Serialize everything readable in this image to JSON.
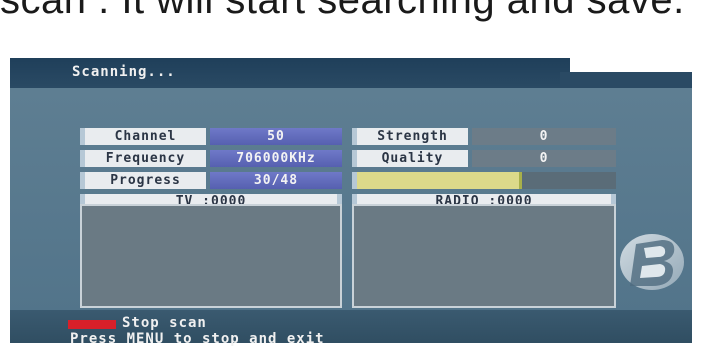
{
  "caption": {
    "text": "scan . It will start searching and save."
  },
  "osd": {
    "title": "Scanning...",
    "fields": {
      "channel": {
        "label": "Channel",
        "value": "50"
      },
      "frequency": {
        "label": "Frequency",
        "value": "706000KHz"
      },
      "progress": {
        "label": "Progress",
        "value": "30/48",
        "fraction": 0.625
      },
      "strength": {
        "label": "Strength",
        "value": "0"
      },
      "quality": {
        "label": "Quality",
        "value": "0"
      }
    },
    "tv_count": "TV :0000",
    "radio_count": "RADIO :0000",
    "footer": {
      "key_label": "Stop scan",
      "hint": "Press MENU to stop and exit"
    },
    "colors": {
      "accent_red": "#d8202a",
      "progress_yellow": "#dcd98a",
      "value_blue": "#5660b0"
    }
  }
}
